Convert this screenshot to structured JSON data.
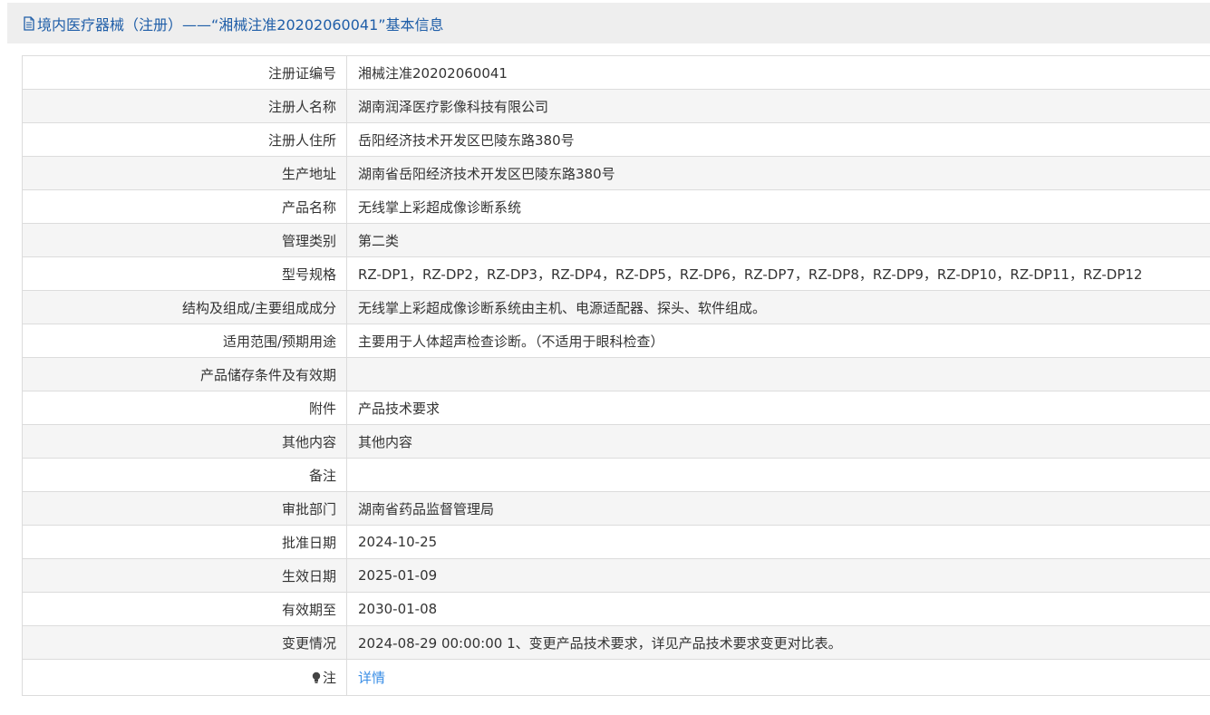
{
  "header": {
    "title": "境内医疗器械（注册）——“湘械注准20202060041”基本信息",
    "icon": "document-icon"
  },
  "rows": [
    {
      "label": "注册证编号",
      "value": "湘械注准20202060041"
    },
    {
      "label": "注册人名称",
      "value": "湖南润泽医疗影像科技有限公司"
    },
    {
      "label": "注册人住所",
      "value": "岳阳经济技术开发区巴陵东路380号"
    },
    {
      "label": "生产地址",
      "value": "湖南省岳阳经济技术开发区巴陵东路380号"
    },
    {
      "label": "产品名称",
      "value": "无线掌上彩超成像诊断系统"
    },
    {
      "label": "管理类别",
      "value": "第二类"
    },
    {
      "label": "型号规格",
      "value": "RZ-DP1，RZ-DP2，RZ-DP3，RZ-DP4，RZ-DP5，RZ-DP6，RZ-DP7，RZ-DP8，RZ-DP9，RZ-DP10，RZ-DP11，RZ-DP12"
    },
    {
      "label": "结构及组成/主要组成成分",
      "value": "无线掌上彩超成像诊断系统由主机、电源适配器、探头、软件组成。"
    },
    {
      "label": "适用范围/预期用途",
      "value": "主要用于人体超声检查诊断。（不适用于眼科检查）"
    },
    {
      "label": "产品储存条件及有效期",
      "value": ""
    },
    {
      "label": "附件",
      "value": "产品技术要求"
    },
    {
      "label": "其他内容",
      "value": "其他内容"
    },
    {
      "label": "备注",
      "value": ""
    },
    {
      "label": "审批部门",
      "value": "湖南省药品监督管理局"
    },
    {
      "label": "批准日期",
      "value": "2024-10-25"
    },
    {
      "label": "生效日期",
      "value": "2025-01-09"
    },
    {
      "label": "有效期至",
      "value": "2030-01-08"
    },
    {
      "label": "变更情况",
      "value": "2024-08-29 00:00:00 1、变更产品技术要求，详见产品技术要求变更对比表。"
    }
  ],
  "note": {
    "label": "注",
    "icon": "lightbulb-icon",
    "link_text": "详情",
    "link_color": "#3a8ee6"
  },
  "colors": {
    "title": "#1f5ea8",
    "header_bg": "#eeeeee",
    "row_alt_bg": "#f5f5f5",
    "border": "#dcdcdc"
  }
}
